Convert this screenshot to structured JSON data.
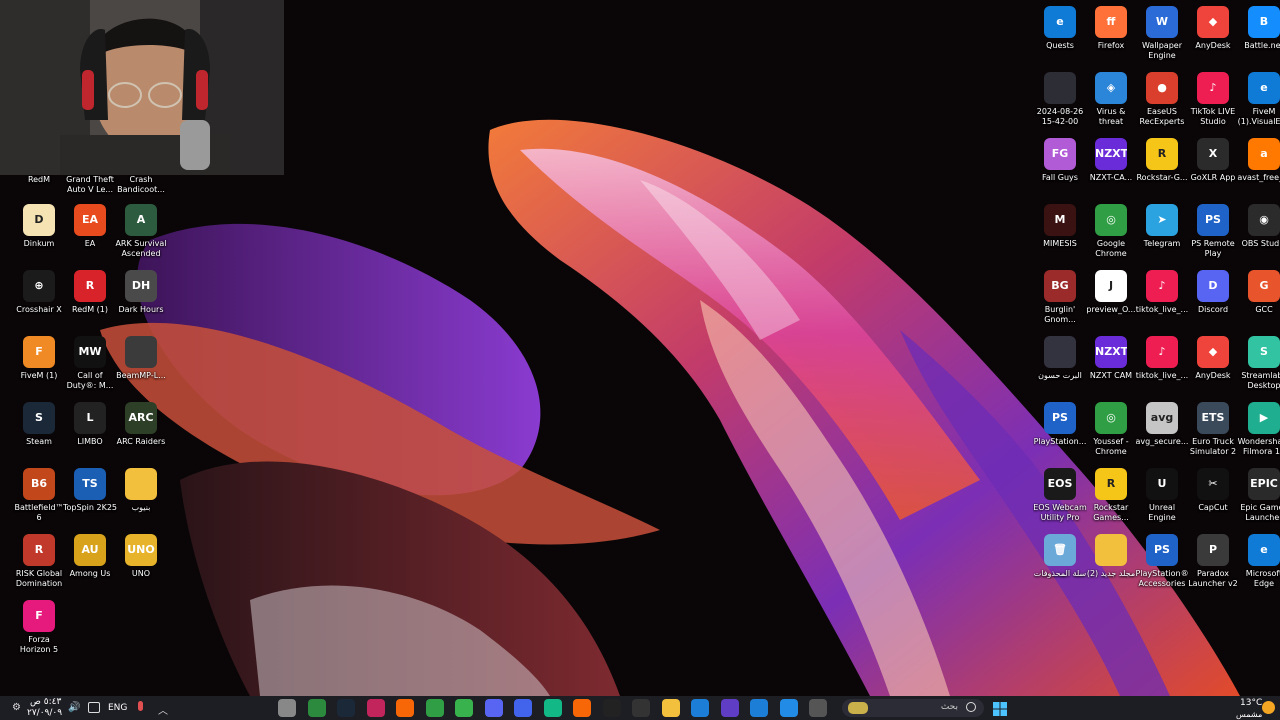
{
  "desktop": {
    "left_icons": [
      {
        "label": "RedM",
        "color": "#c0392b",
        "glyph": ""
      },
      {
        "label": "Grand Theft Auto V Le...",
        "color": "#2c3e50",
        "glyph": ""
      },
      {
        "label": "Crash Bandicoot...",
        "color": "#e67e22",
        "glyph": ""
      },
      {
        "label": "Dinkum",
        "color": "#f5e3b3",
        "glyph": "D"
      },
      {
        "label": "EA",
        "color": "#e84b1e",
        "glyph": "EA"
      },
      {
        "label": "ARK Survival Ascended",
        "color": "#2d5b3f",
        "glyph": "A"
      },
      {
        "label": "Crosshair X",
        "color": "#1b1b1b",
        "glyph": "⊕"
      },
      {
        "label": "RedM (1)",
        "color": "#d8232a",
        "glyph": "R"
      },
      {
        "label": "Dark Hours",
        "color": "#4a4a4a",
        "glyph": "DH"
      },
      {
        "label": "FiveM (1)",
        "color": "#f08a24",
        "glyph": "F"
      },
      {
        "label": "Call of Duty®: M...",
        "color": "#111111",
        "glyph": "MW"
      },
      {
        "label": "BeamMP-L...",
        "color": "#3b3b3b",
        "glyph": ""
      },
      {
        "label": "Steam",
        "color": "#1b2838",
        "glyph": "S"
      },
      {
        "label": "LIMBO",
        "color": "#222222",
        "glyph": "L"
      },
      {
        "label": "ARC Raiders",
        "color": "#2e3f28",
        "glyph": "ARC"
      },
      {
        "label": "Battlefield™ 6",
        "color": "#c2471b",
        "glyph": "B6"
      },
      {
        "label": "TopSpin 2K25",
        "color": "#1a5fb4",
        "glyph": "TS"
      },
      {
        "label": "بنيوب",
        "color": "#f3c03d",
        "glyph": ""
      },
      {
        "label": "RISK Global Domination",
        "color": "#c0392b",
        "glyph": "R"
      },
      {
        "label": "Among Us",
        "color": "#d9a21b",
        "glyph": "AU"
      },
      {
        "label": "UNO",
        "color": "#e6b32a",
        "glyph": "UNO"
      },
      {
        "label": "Forza Horizon 5",
        "color": "#e6197c",
        "glyph": "F"
      }
    ],
    "right_icons": [
      {
        "label": "Quests",
        "color": "#0f7bd7",
        "glyph": "e"
      },
      {
        "label": "Firefox",
        "color": "#ff7139",
        "glyph": "ff"
      },
      {
        "label": "Wallpaper Engine",
        "color": "#2a6bd8",
        "glyph": "W"
      },
      {
        "label": "AnyDesk",
        "color": "#ef443b",
        "glyph": "◆"
      },
      {
        "label": "Battle.net",
        "color": "#148eff",
        "glyph": "B"
      },
      {
        "label": "2024-08-26 15-42-00",
        "color": "#2d2d35",
        "glyph": ""
      },
      {
        "label": "Virus & threat prote...",
        "color": "#2b85d8",
        "glyph": "◈"
      },
      {
        "label": "EaseUS RecExperts",
        "color": "#d93f2c",
        "glyph": "●"
      },
      {
        "label": "TikTok LIVE Studio",
        "color": "#ee1d52",
        "glyph": "♪"
      },
      {
        "label": "FiveM (1).VisualEl...",
        "color": "#0f7bd7",
        "glyph": "e"
      },
      {
        "label": "Fall Guys",
        "color": "#b25bd6",
        "glyph": "FG"
      },
      {
        "label": "NZXT-CA...",
        "color": "#6a2bd8",
        "glyph": "NZXT"
      },
      {
        "label": "Rockstar-G...",
        "color": "#f5c518",
        "glyph": "R"
      },
      {
        "label": "GoXLR App",
        "color": "#2b2b2b",
        "glyph": "X"
      },
      {
        "label": "avast_free_...",
        "color": "#ff7800",
        "glyph": "a"
      },
      {
        "label": "MIMESIS",
        "color": "#3b1212",
        "glyph": "M"
      },
      {
        "label": "Google Chrome",
        "color": "#2f9e44",
        "glyph": "◎"
      },
      {
        "label": "Telegram",
        "color": "#2aa3e0",
        "glyph": "➤"
      },
      {
        "label": "PS Remote Play",
        "color": "#1f63c8",
        "glyph": "PS"
      },
      {
        "label": "OBS Studio",
        "color": "#2b2b2b",
        "glyph": "◉"
      },
      {
        "label": "Burglin' Gnom...",
        "color": "#9b2a2a",
        "glyph": "BG"
      },
      {
        "label": "preview_O...",
        "color": "#ffffff",
        "glyph": "J"
      },
      {
        "label": "tiktok_live_...",
        "color": "#ee1d52",
        "glyph": "♪"
      },
      {
        "label": "Discord",
        "color": "#5865f2",
        "glyph": "D"
      },
      {
        "label": "GCC",
        "color": "#e8542c",
        "glyph": "G"
      },
      {
        "label": "البرت حسون",
        "color": "#333340",
        "glyph": ""
      },
      {
        "label": "NZXT CAM",
        "color": "#6a2bd8",
        "glyph": "NZXT"
      },
      {
        "label": "tiktok_live_...",
        "color": "#ee1d52",
        "glyph": "♪"
      },
      {
        "label": "AnyDesk",
        "color": "#ef443b",
        "glyph": "◆"
      },
      {
        "label": "Streamlabs Desktop",
        "color": "#31c3a2",
        "glyph": "S"
      },
      {
        "label": "PlayStation...",
        "color": "#1f63c8",
        "glyph": "PS"
      },
      {
        "label": "Youssef - Chrome",
        "color": "#2f9e44",
        "glyph": "◎"
      },
      {
        "label": "avg_secure...",
        "color": "#c5c5c5",
        "glyph": "avg"
      },
      {
        "label": "Euro Truck Simulator 2",
        "color": "#3b4a5a",
        "glyph": "ETS"
      },
      {
        "label": "Wondershare Filmora 14",
        "color": "#1fae8f",
        "glyph": "▶"
      },
      {
        "label": "EOS Webcam Utility Pro",
        "color": "#1a1a1a",
        "glyph": "EOS"
      },
      {
        "label": "Rockstar Games...",
        "color": "#f5c518",
        "glyph": "R"
      },
      {
        "label": "Unreal Engine",
        "color": "#111111",
        "glyph": "U"
      },
      {
        "label": "CapCut",
        "color": "#111111",
        "glyph": "✂"
      },
      {
        "label": "Epic Games Launcher",
        "color": "#2a2a2a",
        "glyph": "EPIC"
      },
      {
        "label": "سلة المحذوفات",
        "color": "#6aa9d8",
        "glyph": "🗑"
      },
      {
        "label": "(2) مجلد جديد",
        "color": "#f3c03d",
        "glyph": ""
      },
      {
        "label": "PlayStation® Accessories",
        "color": "#1f63c8",
        "glyph": "PS"
      },
      {
        "label": "Paradox Launcher v2",
        "color": "#3a3a3a",
        "glyph": "P"
      },
      {
        "label": "Microsoft Edge",
        "color": "#0f7bd7",
        "glyph": "e"
      }
    ]
  },
  "taskbar": {
    "clock_time": "٥:٤٣ ص",
    "clock_date": "٢٧/٠٩/٠٩",
    "lang": "ENG",
    "search_placeholder": "بحث",
    "weather_temp": "13°C",
    "weather_desc": "مشمس",
    "apps": [
      {
        "name": "chrome-circle-icon",
        "color": "#888"
      },
      {
        "name": "xbox-bar-icon",
        "color": "#2b8a3e"
      },
      {
        "name": "steam-icon",
        "color": "#1b2838"
      },
      {
        "name": "app-red-icon",
        "color": "#c2255c"
      },
      {
        "name": "brave-icon",
        "color": "#f76707"
      },
      {
        "name": "minecraft-icon",
        "color": "#2f9e44"
      },
      {
        "name": "chrome-icon",
        "color": "#37b24d"
      },
      {
        "name": "discord-icon",
        "color": "#5865f2"
      },
      {
        "name": "app-blue-icon",
        "color": "#4263eb"
      },
      {
        "name": "streamlabs-icon",
        "color": "#12b886"
      },
      {
        "name": "firefox-icon",
        "color": "#f76707"
      },
      {
        "name": "capcut-icon",
        "color": "#222"
      },
      {
        "name": "obs-icon",
        "color": "#333"
      },
      {
        "name": "file-explorer-icon",
        "color": "#f3c03d"
      },
      {
        "name": "store-icon",
        "color": "#1c7ed6"
      },
      {
        "name": "teams-icon",
        "color": "#5f3dc4"
      },
      {
        "name": "edge-icon",
        "color": "#1c7ed6"
      },
      {
        "name": "remote-icon",
        "color": "#228be6"
      },
      {
        "name": "app-gray-icon",
        "color": "#555"
      }
    ]
  }
}
